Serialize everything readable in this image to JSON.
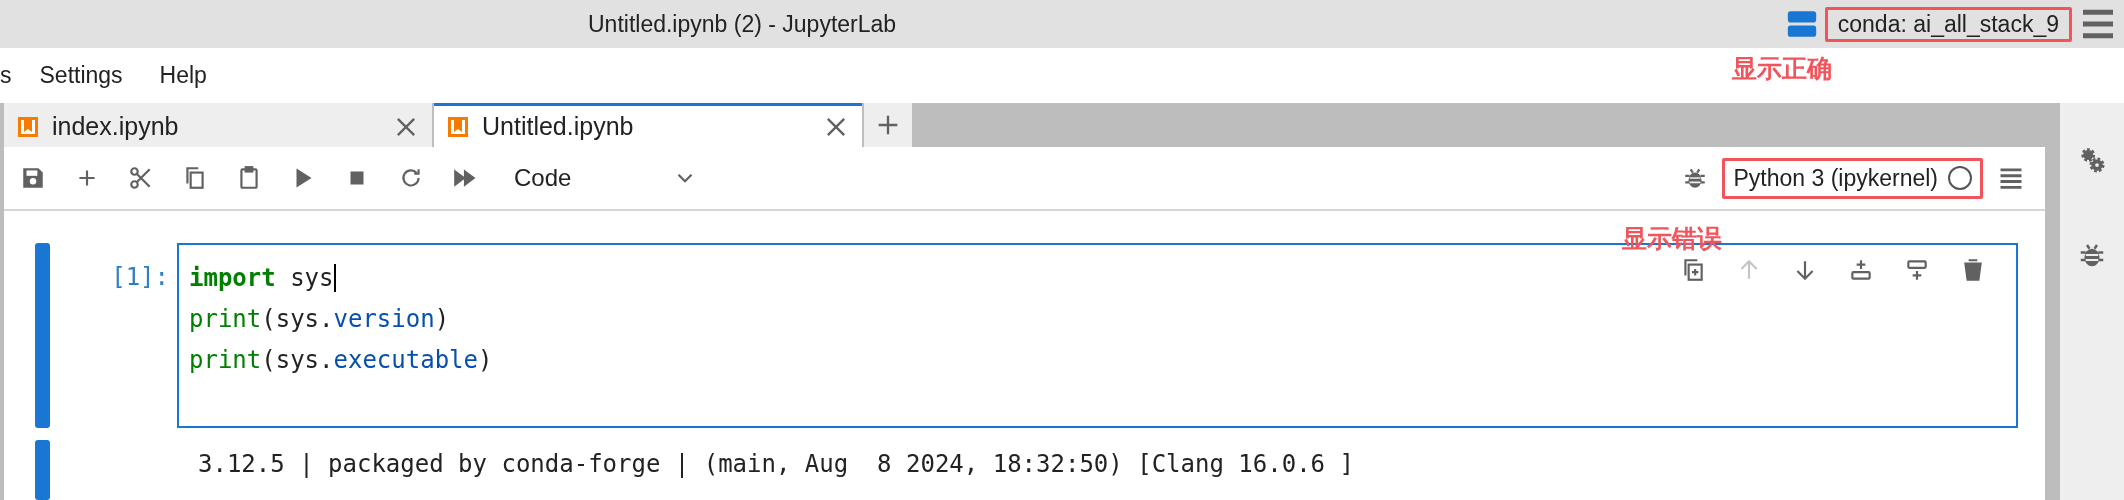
{
  "window": {
    "title": "Untitled.ipynb (2) - JupyterLab",
    "environment": {
      "label": "conda: ai_all_stack_9",
      "highlighted": true
    }
  },
  "menu": [
    "s",
    "Settings",
    "Help"
  ],
  "tabs": [
    {
      "label": "index.ipynb",
      "selected": false
    },
    {
      "label": "Untitled.ipynb",
      "selected": true
    }
  ],
  "toolbar": {
    "buttons": [
      {
        "kind": "save"
      },
      {
        "kind": "add"
      },
      {
        "kind": "cut"
      },
      {
        "kind": "copy"
      },
      {
        "kind": "paste"
      },
      {
        "kind": "run"
      },
      {
        "kind": "stop"
      },
      {
        "kind": "restart"
      },
      {
        "kind": "run-all"
      }
    ],
    "cell_type": "Code",
    "kernel": {
      "label": "Python 3 (ipykernel)",
      "highlighted": true,
      "busy": false
    }
  },
  "annotations": [
    {
      "text": "显示正确"
    },
    {
      "text": "显示错误"
    }
  ],
  "cell": {
    "prompt": "[1]:",
    "active": true,
    "lines": [
      [
        {
          "text": "import",
          "kind": "keyword"
        },
        {
          "text": " sys",
          "kind": "name",
          "cursor": true
        }
      ],
      [
        {
          "text": "print",
          "kind": "builtin"
        },
        {
          "text": "(sys.",
          "kind": "name"
        },
        {
          "text": "version",
          "kind": "attr"
        },
        {
          "text": ")",
          "kind": "name"
        }
      ],
      [
        {
          "text": "print",
          "kind": "builtin"
        },
        {
          "text": "(sys.",
          "kind": "name"
        },
        {
          "text": "executable",
          "kind": "attr"
        },
        {
          "text": ")",
          "kind": "name"
        }
      ]
    ],
    "actions": [
      {
        "kind": "duplicate",
        "disabled": false
      },
      {
        "kind": "up",
        "disabled": true
      },
      {
        "kind": "down",
        "disabled": false
      },
      {
        "kind": "insert-above",
        "disabled": false
      },
      {
        "kind": "insert-below",
        "disabled": false
      },
      {
        "kind": "delete",
        "disabled": false
      }
    ],
    "output": "3.12.5 | packaged by conda-forge | (main, Aug  8 2024, 18:32:50) [Clang 16.0.6 ]"
  },
  "sidebar": [
    {
      "kind": "settings"
    },
    {
      "kind": "debugger"
    }
  ]
}
